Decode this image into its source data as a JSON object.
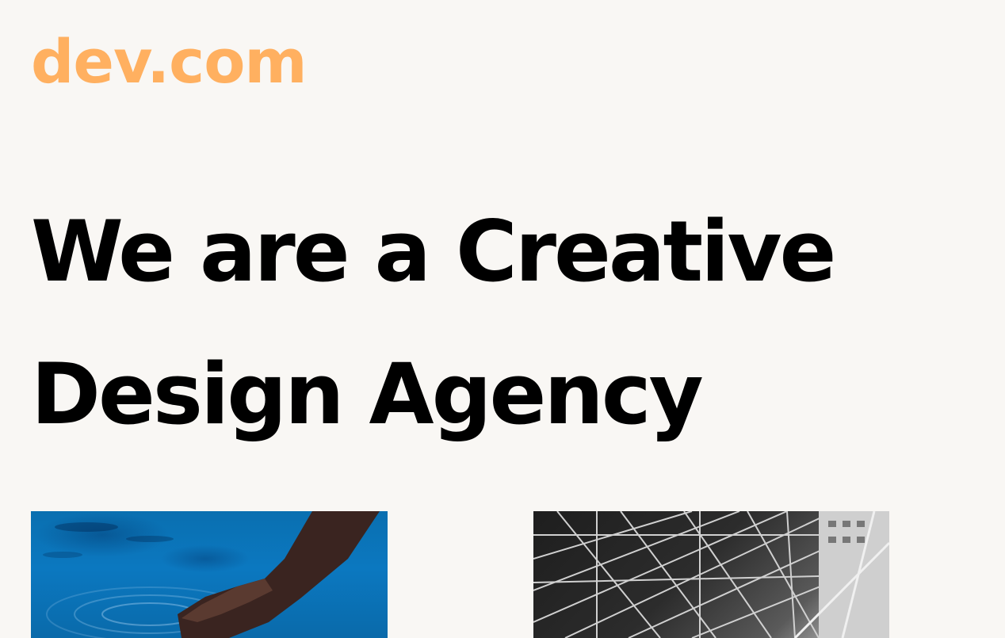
{
  "header": {
    "logo_text": "dev.com"
  },
  "hero": {
    "headline_line1": "We are a Creative",
    "headline_line2": "Design Agency"
  },
  "gallery": [
    {
      "subject": "hand-touching-water-photo"
    },
    {
      "subject": "steel-structure-photo"
    }
  ],
  "colors": {
    "background": "#f9f7f4",
    "logo": "#ffb060",
    "headline": "#000000"
  }
}
